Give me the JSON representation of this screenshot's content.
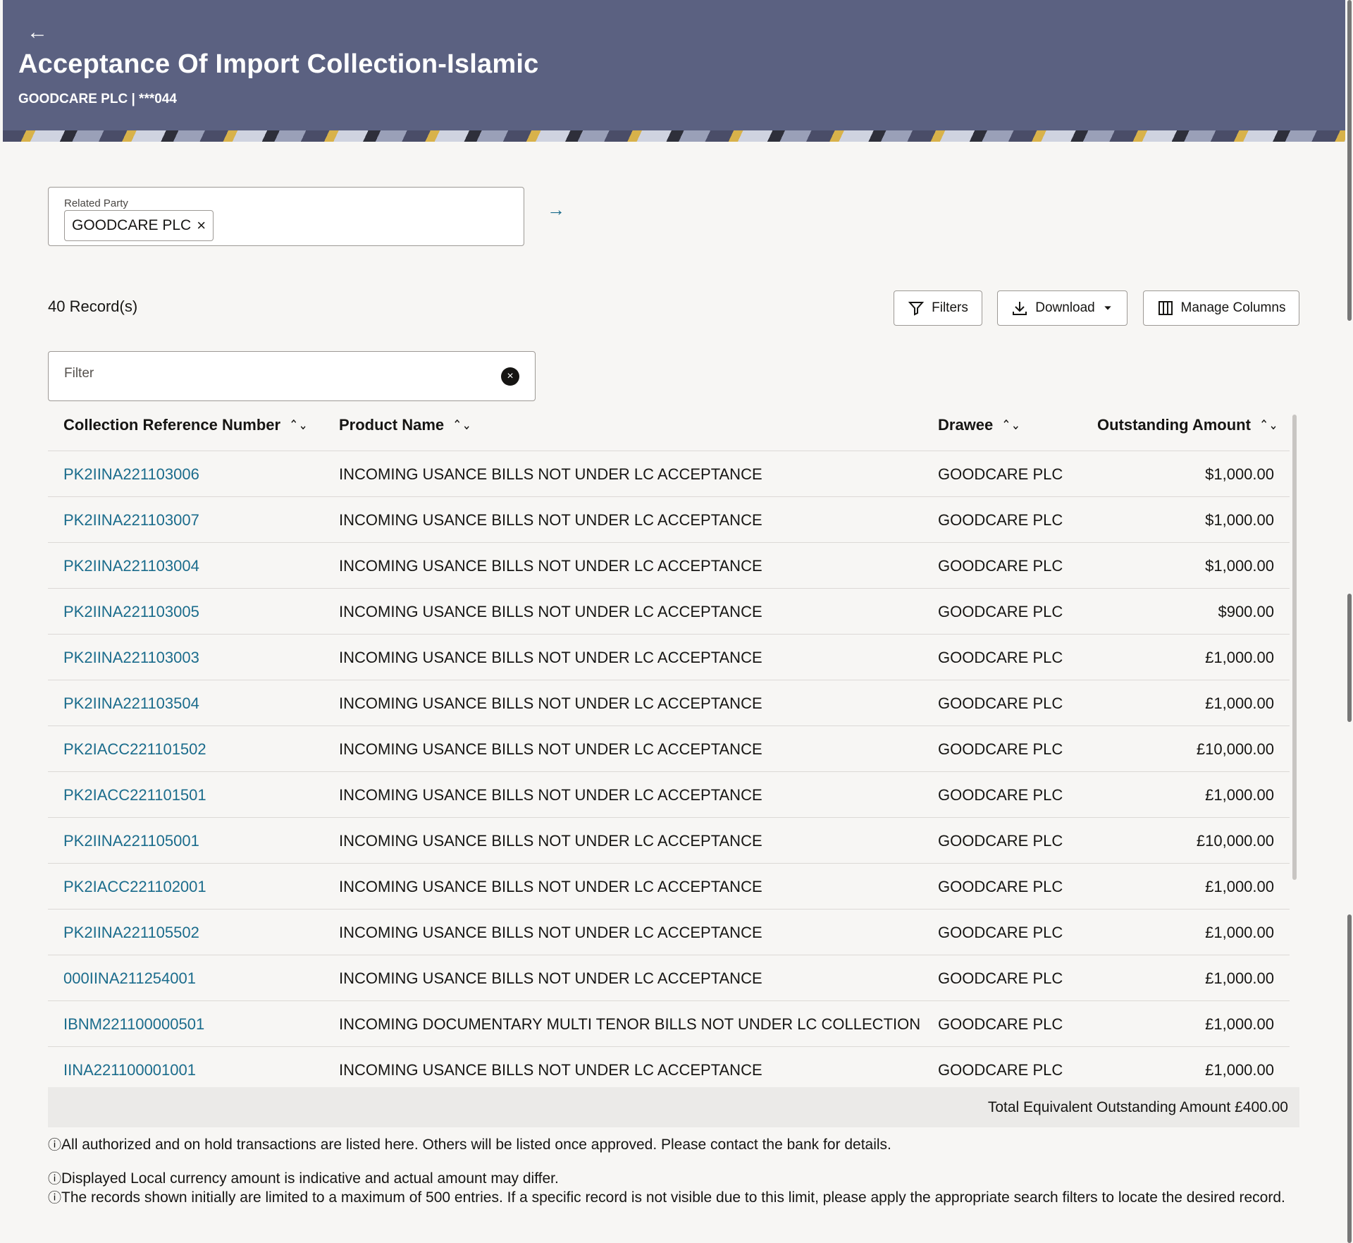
{
  "header": {
    "title": "Acceptance Of Import Collection-Islamic",
    "subtitle": "GOODCARE PLC | ***044",
    "back_icon": "←"
  },
  "related_party": {
    "label": "Related Party",
    "selected": "GOODCARE PLC",
    "remove_icon": "×",
    "go_icon": "→"
  },
  "toolbar": {
    "record_count": "40 Record(s)",
    "filters_label": "Filters",
    "download_label": "Download",
    "manage_columns_label": "Manage Columns"
  },
  "filter": {
    "placeholder": "Filter",
    "clear_icon": "×"
  },
  "table": {
    "columns": [
      "Collection Reference Number",
      "Product Name",
      "Drawee",
      "Outstanding Amount"
    ],
    "rows": [
      {
        "ref": "PK2IINA221103006",
        "product": "INCOMING USANCE BILLS NOT UNDER LC ACCEPTANCE",
        "drawee": "GOODCARE PLC",
        "amount": "$1,000.00"
      },
      {
        "ref": "PK2IINA221103007",
        "product": "INCOMING USANCE BILLS NOT UNDER LC ACCEPTANCE",
        "drawee": "GOODCARE PLC",
        "amount": "$1,000.00"
      },
      {
        "ref": "PK2IINA221103004",
        "product": "INCOMING USANCE BILLS NOT UNDER LC ACCEPTANCE",
        "drawee": "GOODCARE PLC",
        "amount": "$1,000.00"
      },
      {
        "ref": "PK2IINA221103005",
        "product": "INCOMING USANCE BILLS NOT UNDER LC ACCEPTANCE",
        "drawee": "GOODCARE PLC",
        "amount": "$900.00"
      },
      {
        "ref": "PK2IINA221103003",
        "product": "INCOMING USANCE BILLS NOT UNDER LC ACCEPTANCE",
        "drawee": "GOODCARE PLC",
        "amount": "£1,000.00"
      },
      {
        "ref": "PK2IINA221103504",
        "product": "INCOMING USANCE BILLS NOT UNDER LC ACCEPTANCE",
        "drawee": "GOODCARE PLC",
        "amount": "£1,000.00"
      },
      {
        "ref": "PK2IACC221101502",
        "product": "INCOMING USANCE BILLS NOT UNDER LC ACCEPTANCE",
        "drawee": "GOODCARE PLC",
        "amount": "£10,000.00"
      },
      {
        "ref": "PK2IACC221101501",
        "product": "INCOMING USANCE BILLS NOT UNDER LC ACCEPTANCE",
        "drawee": "GOODCARE PLC",
        "amount": "£1,000.00"
      },
      {
        "ref": "PK2IINA221105001",
        "product": "INCOMING USANCE BILLS NOT UNDER LC ACCEPTANCE",
        "drawee": "GOODCARE PLC",
        "amount": "£10,000.00"
      },
      {
        "ref": "PK2IACC221102001",
        "product": "INCOMING USANCE BILLS NOT UNDER LC ACCEPTANCE",
        "drawee": "GOODCARE PLC",
        "amount": "£1,000.00"
      },
      {
        "ref": "PK2IINA221105502",
        "product": "INCOMING USANCE BILLS NOT UNDER LC ACCEPTANCE",
        "drawee": "GOODCARE PLC",
        "amount": "£1,000.00"
      },
      {
        "ref": "000IINA211254001",
        "product": "INCOMING USANCE BILLS NOT UNDER LC ACCEPTANCE",
        "drawee": "GOODCARE PLC",
        "amount": "£1,000.00"
      },
      {
        "ref": "IBNM221100000501",
        "product": "INCOMING DOCUMENTARY MULTI TENOR BILLS NOT UNDER LC COLLECTION",
        "drawee": "GOODCARE PLC",
        "amount": "£1,000.00"
      },
      {
        "ref": "IINA221100001001",
        "product": "INCOMING USANCE BILLS NOT UNDER LC ACCEPTANCE",
        "drawee": "GOODCARE PLC",
        "amount": "£1,000.00"
      }
    ],
    "total": "Total Equivalent Outstanding Amount £400.00"
  },
  "notes": [
    "All authorized and on hold transactions are listed here. Others will be listed once approved. Please contact the bank for details.",
    "Displayed Local currency amount is indicative and actual amount may differ.",
    "The records shown initially are limited to a maximum of 500 entries. If a specific record is not visible due to this limit, please apply the appropriate search filters to locate the desired record."
  ],
  "icons": {
    "info": "ⓘ",
    "sort": "⌃⌄"
  },
  "colors": {
    "header_bg": "#5b6181",
    "link": "#1b6c8c"
  }
}
